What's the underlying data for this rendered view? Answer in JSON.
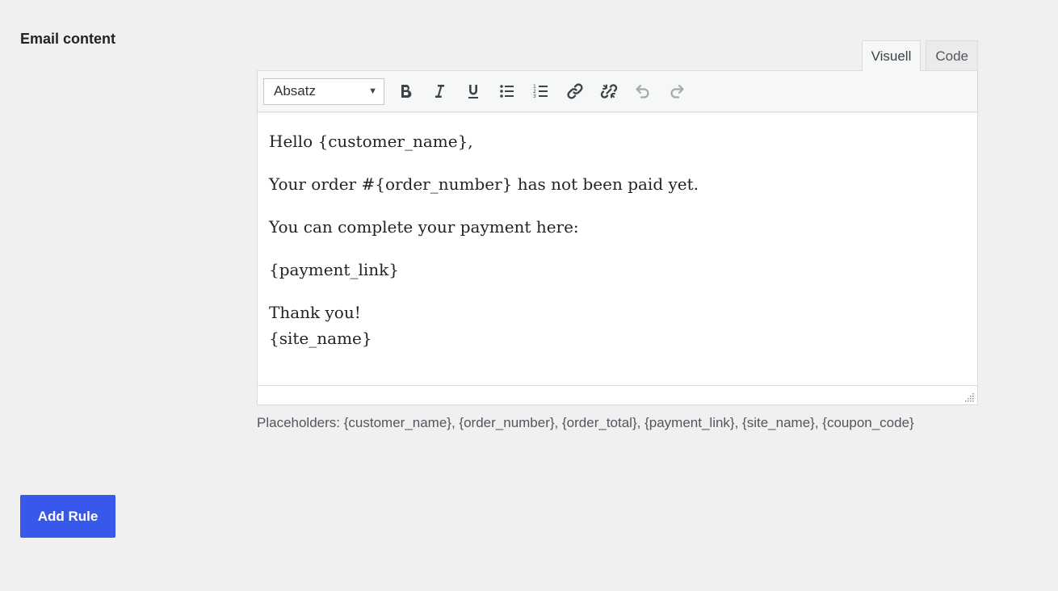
{
  "section": {
    "label": "Email content"
  },
  "editor": {
    "tabs": [
      {
        "label": "Visuell",
        "active": true
      },
      {
        "label": "Code",
        "active": false
      }
    ],
    "toolbar": {
      "format_select": "Absatz",
      "buttons": [
        {
          "name": "bold-icon",
          "label": "Bold"
        },
        {
          "name": "italic-icon",
          "label": "Italic"
        },
        {
          "name": "underline-icon",
          "label": "Underline"
        },
        {
          "name": "bullet-list-icon",
          "label": "Bulleted list"
        },
        {
          "name": "numbered-list-icon",
          "label": "Numbered list"
        },
        {
          "name": "link-icon",
          "label": "Insert link"
        },
        {
          "name": "unlink-icon",
          "label": "Remove link"
        },
        {
          "name": "undo-icon",
          "label": "Undo"
        },
        {
          "name": "redo-icon",
          "label": "Redo"
        }
      ]
    },
    "content": {
      "line1": "Hello {customer_name},",
      "line2": "Your order #{order_number} has not been paid yet.",
      "line3": "You can complete your payment here:",
      "line4": "{payment_link}",
      "line5a": "Thank you!",
      "line5b": "{site_name}"
    },
    "help_text": "Placeholders: {customer_name}, {order_number}, {order_total}, {payment_link}, {site_name}, {coupon_code}"
  },
  "actions": {
    "add_rule_label": "Add Rule"
  },
  "colors": {
    "background": "#f0f0f1",
    "primary_button": "#3858e9",
    "toolbar": "#f6f7f7",
    "border": "#dcdcde",
    "icon": "#3c434a",
    "icon_disabled": "#a7aaad"
  }
}
